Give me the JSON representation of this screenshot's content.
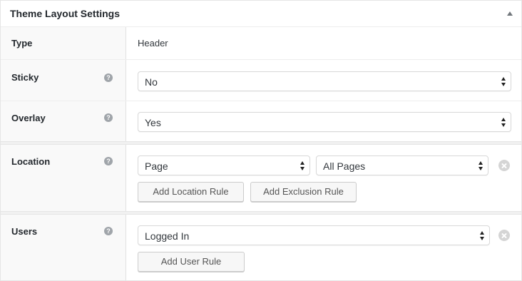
{
  "panel": {
    "title": "Theme Layout Settings",
    "toggle_icon": "arrow-up-icon"
  },
  "rows": {
    "type": {
      "label": "Type",
      "value": "Header"
    },
    "sticky": {
      "label": "Sticky",
      "help_glyph": "?",
      "selected": "No"
    },
    "overlay": {
      "label": "Overlay",
      "help_glyph": "?",
      "selected": "Yes"
    },
    "location": {
      "label": "Location",
      "help_glyph": "?",
      "rule_type_selected": "Page",
      "rule_value_selected": "All Pages",
      "add_location_label": "Add Location Rule",
      "add_exclusion_label": "Add Exclusion Rule"
    },
    "users": {
      "label": "Users",
      "help_glyph": "?",
      "selected": "Logged In",
      "add_user_label": "Add User Rule"
    }
  },
  "colors": {
    "label_bg": "#f9f9f9",
    "border": "#e5e5e5",
    "help_icon": "#a0a5aa",
    "remove_icon": "#d5d5d5"
  }
}
